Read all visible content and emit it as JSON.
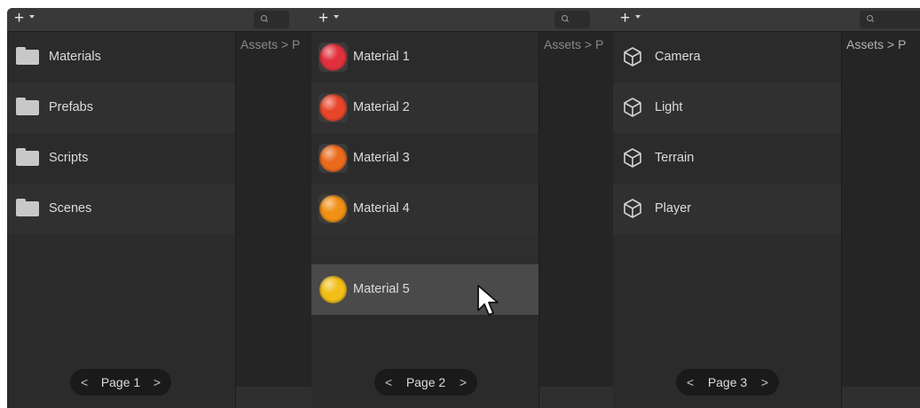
{
  "colors": {
    "panel_bg": "#2b2b2b",
    "row_alt": "#303030",
    "row_selected": "#4a4a4a",
    "pager_bg": "#1a1a1a"
  },
  "panels": [
    {
      "toolbar": {
        "add_label": "+"
      },
      "breadcrumb": "Assets > P",
      "items": [
        {
          "label": "Materials",
          "icon": "folder-icon"
        },
        {
          "label": "Prefabs",
          "icon": "folder-icon"
        },
        {
          "label": "Scripts",
          "icon": "folder-icon"
        },
        {
          "label": "Scenes",
          "icon": "folder-icon"
        }
      ],
      "pager": {
        "label": "Page 1",
        "prev": "<",
        "next": ">"
      }
    },
    {
      "toolbar": {
        "add_label": "+"
      },
      "breadcrumb": "Assets > P",
      "items": [
        {
          "label": "Material 1",
          "icon": "material-sphere-icon",
          "color": "#e0303c"
        },
        {
          "label": "Material 2",
          "icon": "material-sphere-icon",
          "color": "#e8452a"
        },
        {
          "label": "Material 3",
          "icon": "material-sphere-icon",
          "color": "#ec6a1c"
        },
        {
          "label": "Material 4",
          "icon": "material-sphere-icon",
          "color": "#f09014"
        },
        {
          "label": "Material 5",
          "icon": "material-sphere-icon",
          "color": "#f2be18",
          "selected": true
        }
      ],
      "pager": {
        "label": "Page 2",
        "prev": "<",
        "next": ">"
      }
    },
    {
      "toolbar": {
        "add_label": "+"
      },
      "breadcrumb": "Assets > P",
      "items": [
        {
          "label": "Camera",
          "icon": "cube-icon"
        },
        {
          "label": "Light",
          "icon": "cube-icon"
        },
        {
          "label": "Terrain",
          "icon": "cube-icon"
        },
        {
          "label": "Player",
          "icon": "cube-icon"
        }
      ],
      "pager": {
        "label": "Page 3",
        "prev": "<",
        "next": ">"
      }
    }
  ]
}
